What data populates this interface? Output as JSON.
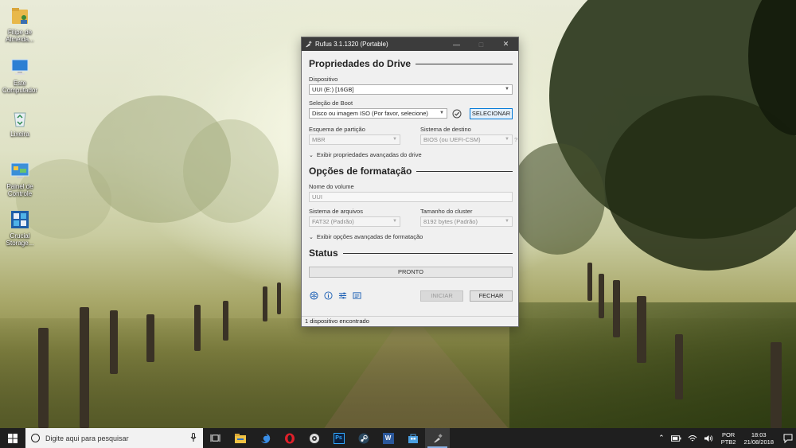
{
  "desktop": {
    "icons": [
      {
        "label": "Filipe de Almeida...",
        "icon": "user-folder-icon"
      },
      {
        "label": "Este Computador",
        "icon": "computer-icon"
      },
      {
        "label": "Lixeira",
        "icon": "recycle-bin-icon"
      },
      {
        "label": "Painel de Controle",
        "icon": "control-panel-icon"
      },
      {
        "label": "Crucial Storage...",
        "icon": "storage-executive-icon"
      }
    ]
  },
  "window": {
    "title": "Rufus 3.1.1320 (Portable)",
    "drive_section": {
      "heading": "Propriedades do Drive",
      "device_label": "Dispositivo",
      "device_value": "UUI (E:) [16GB]",
      "boot_label": "Seleção de Boot",
      "boot_value": "Disco ou imagem ISO (Por favor, selecione)",
      "select_button": "SELECIONAR",
      "partition_label": "Esquema de partição",
      "partition_value": "MBR",
      "target_label": "Sistema de destino",
      "target_value": "BIOS (ou UEFI-CSM)",
      "target_help": "?",
      "advanced_toggle": "Exibir propriedades avançadas do drive"
    },
    "format_section": {
      "heading": "Opções de formatação",
      "volume_label": "Nome do volume",
      "volume_value": "UUI",
      "fs_label": "Sistema de arquivos",
      "fs_value": "FAT32 (Padrão)",
      "cluster_label": "Tamanho do cluster",
      "cluster_value": "8192 bytes (Padrão)",
      "advanced_toggle": "Exibir opções avançadas de formatação"
    },
    "status_section": {
      "heading": "Status",
      "progress_text": "PRONTO"
    },
    "start_button": "INICIAR",
    "close_button": "FECHAR",
    "status_bar": "1 dispositivo encontrado",
    "tool_icons": [
      "globe-icon",
      "info-icon",
      "settings-sliders-icon",
      "log-icon"
    ]
  },
  "taskbar": {
    "search_placeholder": "Digite aqui para pesquisar",
    "apps": [
      "task-view-icon",
      "file-explorer-icon",
      "edge-icon",
      "opera-icon",
      "camera-app-icon",
      "photoshop-icon",
      "steam-icon",
      "word-icon",
      "store-icon",
      "rufus-icon"
    ],
    "photoshop_label": "Ps",
    "word_label": "W",
    "language_top": "POR",
    "language_bottom": "PTB2",
    "time": "18:03",
    "date": "21/08/2018"
  }
}
